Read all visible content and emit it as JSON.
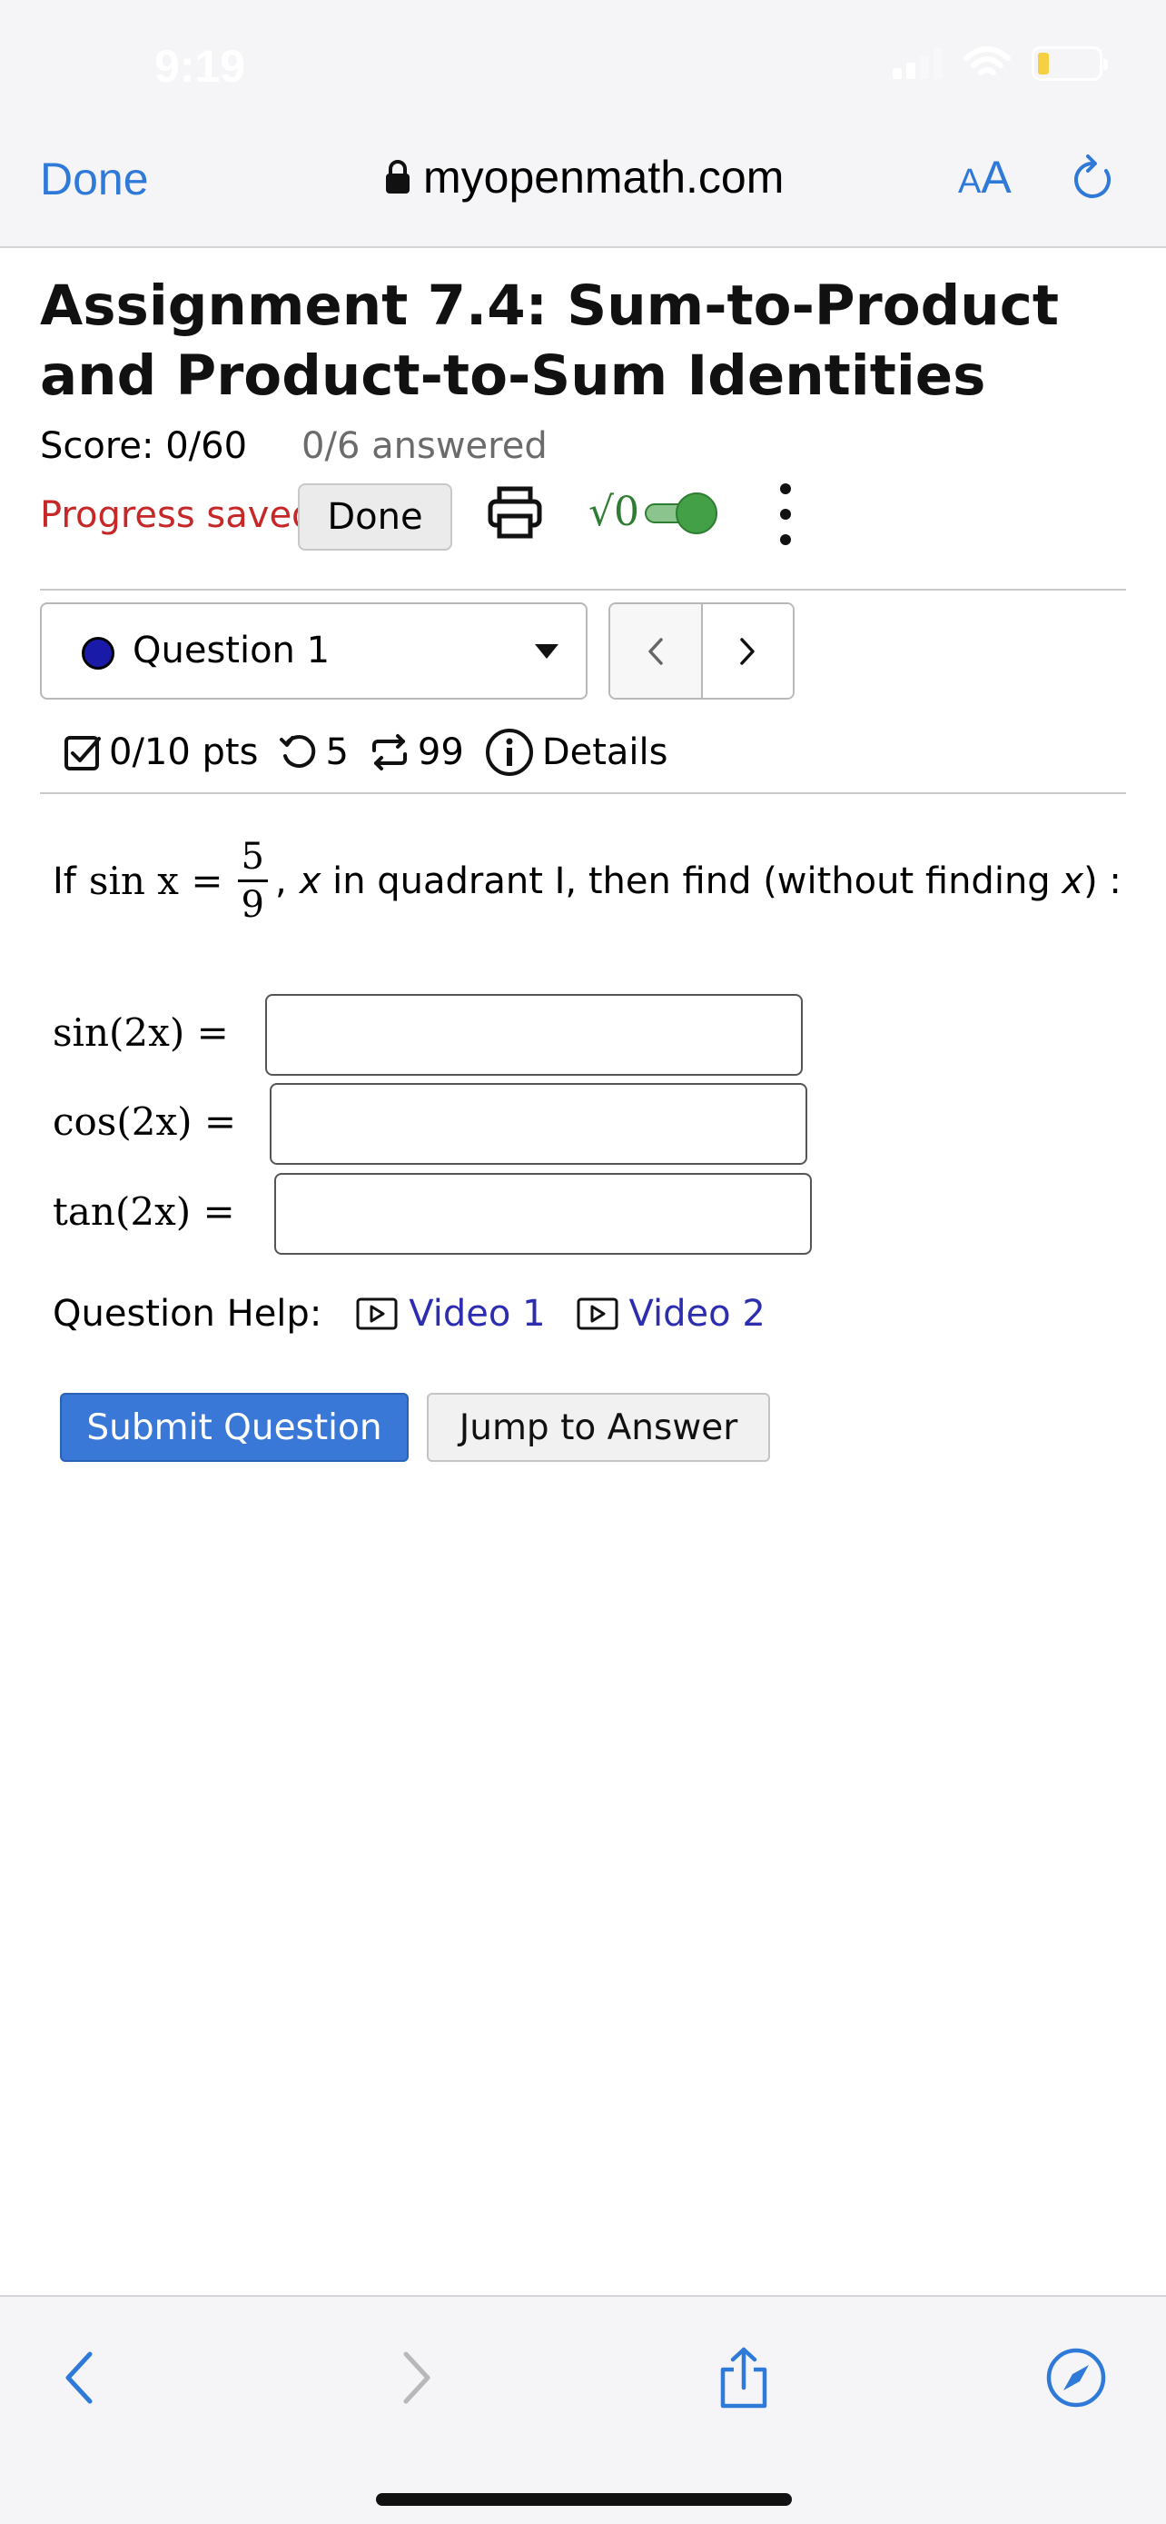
{
  "status_bar": {
    "time": "9:19"
  },
  "browser": {
    "done_label": "Done",
    "url": "myopenmath.com",
    "aa_small": "A",
    "aa_large": "A"
  },
  "assignment": {
    "title": "Assignment 7.4: Sum-to-Product and Product-to-Sum Identities",
    "score": "Score: 0/60",
    "answered": "0/6 answered",
    "progress_status": "Progress saved",
    "done_button": "Done",
    "math_toggle_label": "√0"
  },
  "question_nav": {
    "selected": "Question 1",
    "prev": "<",
    "next": ">"
  },
  "question_meta": {
    "points": "0/10 pts",
    "retries": "5",
    "attempts": "99",
    "details": "Details"
  },
  "problem": {
    "prefix": "If",
    "expr": "sin x =",
    "frac_num": "5",
    "frac_den": "9",
    "comma": ",",
    "x_var": "x",
    "mid_text": " in quadrant I, then find (without finding ",
    "x_var2": "x",
    "suffix": ") :",
    "answers": [
      {
        "label": "sin(2x) =",
        "value": ""
      },
      {
        "label": "cos(2x) =",
        "value": ""
      },
      {
        "label": "tan(2x) =",
        "value": ""
      }
    ]
  },
  "help": {
    "label": "Question Help:",
    "videos": [
      "Video 1",
      "Video 2"
    ]
  },
  "actions": {
    "submit": "Submit Question",
    "jump": "Jump to Answer"
  },
  "colors": {
    "link_blue": "#2f7ad9",
    "progress_red": "#c62828",
    "submit_blue": "#3a78d8",
    "toggle_green": "#43a047",
    "video_link": "#2d2db0"
  }
}
